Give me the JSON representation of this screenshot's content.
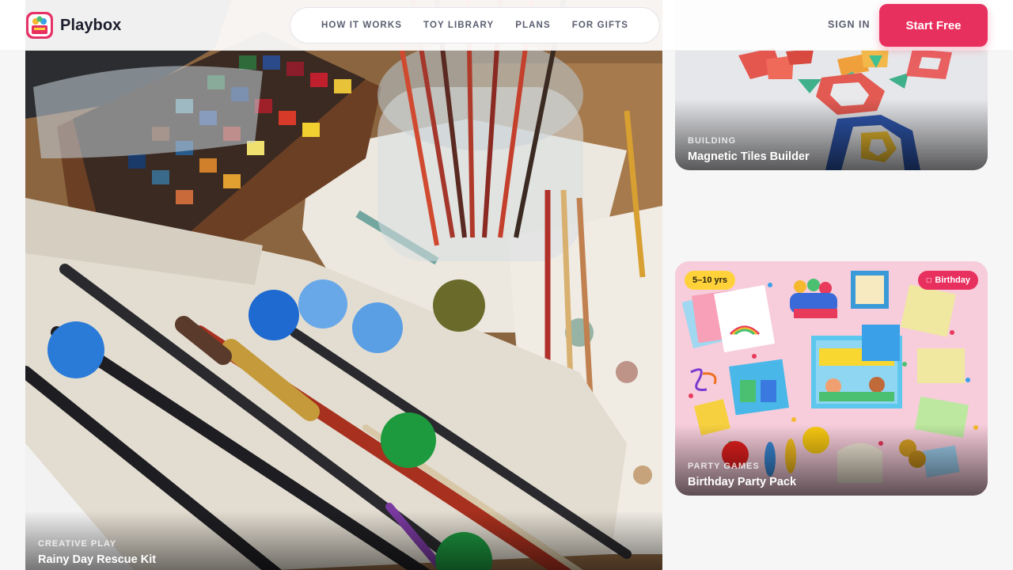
{
  "brand": {
    "name": "Playbox",
    "accent": "#e8305f"
  },
  "nav": {
    "links": [
      "HOW IT WORKS",
      "TOY LIBRARY",
      "PLANS",
      "FOR GIFTS"
    ]
  },
  "auth": {
    "sign_in": "SIGN IN",
    "cta": "Start Free"
  },
  "cards": [
    {
      "category": "CREATIVE PLAY",
      "title": "Rainy Day Rescue Kit"
    },
    {
      "category": "BUILDING",
      "title": "Magnetic Tiles Builder"
    },
    {
      "category": "PARTY GAMES",
      "title": "Birthday Party Pack",
      "age_badge": "5–10 yrs",
      "occasion_badge": "Birthday",
      "occasion_icon": "gift-icon"
    }
  ]
}
